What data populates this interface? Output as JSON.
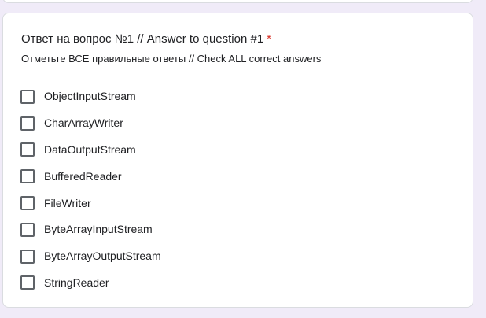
{
  "question": {
    "title": "Ответ на вопрос №1 // Answer to question #1",
    "required_mark": "*",
    "description": "Отметьте ВСЕ правильные ответы // Check ALL correct answers",
    "options": [
      {
        "label": "ObjectInputStream",
        "checked": false
      },
      {
        "label": "CharArrayWriter",
        "checked": false
      },
      {
        "label": "DataOutputStream",
        "checked": false
      },
      {
        "label": "BufferedReader",
        "checked": false
      },
      {
        "label": "FileWriter",
        "checked": false
      },
      {
        "label": "ByteArrayInputStream",
        "checked": false
      },
      {
        "label": "ByteArrayOutputStream",
        "checked": false
      },
      {
        "label": "StringReader",
        "checked": false
      }
    ]
  },
  "colors": {
    "page_background": "#f0ebf8",
    "card_background": "#ffffff",
    "card_border": "#dadce0",
    "text": "#202124",
    "required": "#d93025",
    "checkbox_border": "#5f6368"
  }
}
